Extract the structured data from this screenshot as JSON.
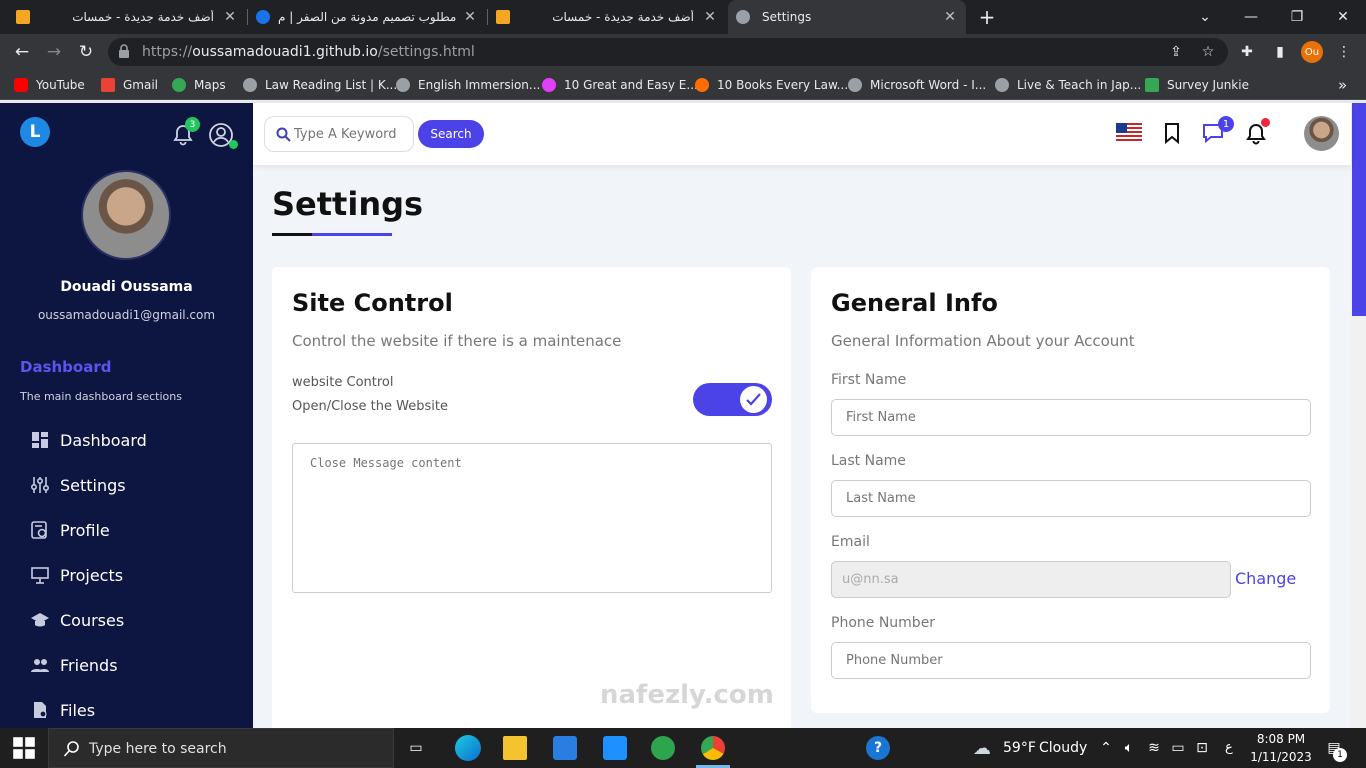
{
  "browser": {
    "tabs": [
      {
        "title": "أضف خدمة جديدة - خمسات",
        "favicon_color": "#f5a623"
      },
      {
        "title": "مطلوب تصميم مدونة من الصفر | م",
        "favicon_color": "#1a73e8"
      },
      {
        "title": "أضف خدمة جديدة - خمسات",
        "favicon_color": "#f5a623"
      },
      {
        "title": "Settings",
        "favicon_color": "#9aa0a6"
      }
    ],
    "new_tab": "+",
    "url_prefix": "https://",
    "url_host": "oussamadouadi1.github.io",
    "url_path": "/settings.html",
    "profile_badge": "Ou",
    "bookmarks": [
      {
        "label": "YouTube",
        "color": "#ff0000"
      },
      {
        "label": "Gmail",
        "color": "#ea4335"
      },
      {
        "label": "Maps",
        "color": "#34a853"
      },
      {
        "label": "Law Reading List | K...",
        "color": "#9aa0a6"
      },
      {
        "label": "English Immersion...",
        "color": "#9aa0a6"
      },
      {
        "label": "10 Great and Easy E...",
        "color": "#e040fb"
      },
      {
        "label": "10 Books Every Law...",
        "color": "#ff6d00"
      },
      {
        "label": "Microsoft Word - I...",
        "color": "#9aa0a6"
      },
      {
        "label": "Live & Teach in Jap...",
        "color": "#9aa0a6"
      },
      {
        "label": "Survey Junkie",
        "color": "#34a853"
      }
    ],
    "bookmarks_more": "»"
  },
  "sidebar": {
    "logo_letter": "L",
    "notification_count": "3",
    "user_name": "Douadi Oussama",
    "user_email": "oussamadouadi1@gmail.com",
    "section_title": "Dashboard",
    "section_subtitle": "The main dashboard sections",
    "items": [
      {
        "label": "Dashboard",
        "icon": "grid-icon"
      },
      {
        "label": "Settings",
        "icon": "sliders-icon"
      },
      {
        "label": "Profile",
        "icon": "user-card-icon"
      },
      {
        "label": "Projects",
        "icon": "presentation-icon"
      },
      {
        "label": "Courses",
        "icon": "graduation-cap-icon"
      },
      {
        "label": "Friends",
        "icon": "users-icon"
      },
      {
        "label": "Files",
        "icon": "file-icon"
      }
    ]
  },
  "topbar": {
    "search_placeholder": "Type A Keyword",
    "search_button": "Search",
    "messages_count": "1"
  },
  "page": {
    "title": "Settings",
    "accent": "#4b42e8"
  },
  "site_control": {
    "title": "Site Control",
    "subtitle": "Control the website if there is a maintenace",
    "toggle_label": "website Control",
    "toggle_desc": "Open/Close the Website",
    "toggle_on": true,
    "message_placeholder": "Close Message content"
  },
  "general_info": {
    "title": "General Info",
    "subtitle": "General Information About your Account",
    "first_name_label": "First Name",
    "first_name_placeholder": "First Name",
    "last_name_label": "Last Name",
    "last_name_placeholder": "Last Name",
    "email_label": "Email",
    "email_value": "u@nn.sa",
    "change_link": "Change",
    "phone_label": "Phone Number",
    "phone_placeholder": "Phone Number"
  },
  "taskbar": {
    "search_placeholder": "Type here to search",
    "weather_temp": "59°F",
    "weather_desc": "Cloudy",
    "lang": "ع",
    "time": "8:08 PM",
    "date": "1/11/2023",
    "notif_count": "1"
  },
  "watermark": "nafezly.com"
}
